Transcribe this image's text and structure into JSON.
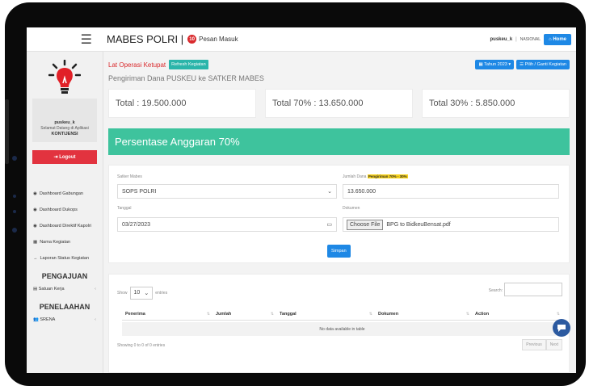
{
  "header": {
    "app_title": "MABES POLRI |",
    "badge": "10",
    "messages": "Pesan Masuk",
    "user": "puskeu_k",
    "role": "NASIONAL",
    "home": "Home"
  },
  "sidebar": {
    "username": "puskeu_k",
    "welcome": "Selamat Datang di Aplikasi",
    "app": "KONTIJENSI",
    "logout": "Logout",
    "items": [
      "Dashboard Gabungan",
      "Dashboard Dukops",
      "Dashboard Direktif Kapolri",
      "Nama Kegiatan",
      "Laporan Status Kegiatan"
    ],
    "section_pengajuan": "PENGAJUAN",
    "satuan_kerja": "Satuan Kerja",
    "section_penelaahan": "PENELAAHAN",
    "srena": "SRENA"
  },
  "toolbar": {
    "ops_title": "Lat Operasi Ketupat",
    "refresh": "Refresh Kegiatan",
    "year": "Tahun 2023",
    "change_activity": "Pilih / Ganti Kegiatan"
  },
  "page": {
    "subtitle": "Pengiriman Dana PUSKEU ke SATKER MABES",
    "total": "Total : 19.500.000",
    "total70": "Total 70% : 13.650.000",
    "total30": "Total 30% : 5.850.000",
    "banner": "Persentase Anggaran 70%"
  },
  "form": {
    "satker_label": "Satker Mabes",
    "satker_value": "SOPS POLRI",
    "jumlah_label": "Jumlah Dana",
    "jumlah_badge": "Pengiriman 70% - 30%",
    "jumlah_value": "13.650.000",
    "tanggal_label": "Tanggal",
    "tanggal_value": "03/27/2023",
    "dokumen_label": "Dokumen",
    "choose_file": "Choose File",
    "file_name": "BPG to BidkeuBensat.pdf",
    "submit": "Simpan"
  },
  "table": {
    "show": "Show",
    "entries_count": "10",
    "entries": "entries",
    "search_label": "Search:",
    "columns": [
      "Penerima",
      "Jumlah",
      "Tanggal",
      "Dokumen",
      "Action"
    ],
    "empty": "No data available in table",
    "showing": "Showing 0 to 0 of 0 entries",
    "previous": "Previous",
    "next": "Next"
  },
  "colors": {
    "accent": "#1e88e5",
    "banner": "#3ec39d",
    "danger": "#e2333f",
    "refresh": "#2bb5aa"
  }
}
